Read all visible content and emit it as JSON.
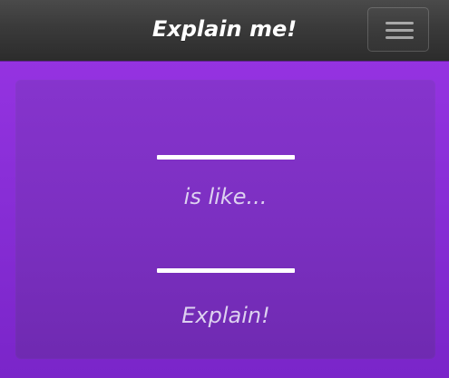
{
  "navbar": {
    "brand": "Explain me!",
    "menu_icon": "hamburger-menu-icon"
  },
  "main": {
    "prompt_blank_1": "",
    "connector_text": "is like...",
    "prompt_blank_2": "",
    "action_label": "Explain!"
  },
  "colors": {
    "page_background": "#9b35e6",
    "card_background": "#8634cd",
    "navbar_background": "#3a3a3a",
    "text_primary": "#ffffff",
    "text_muted": "#ddd1f0"
  }
}
